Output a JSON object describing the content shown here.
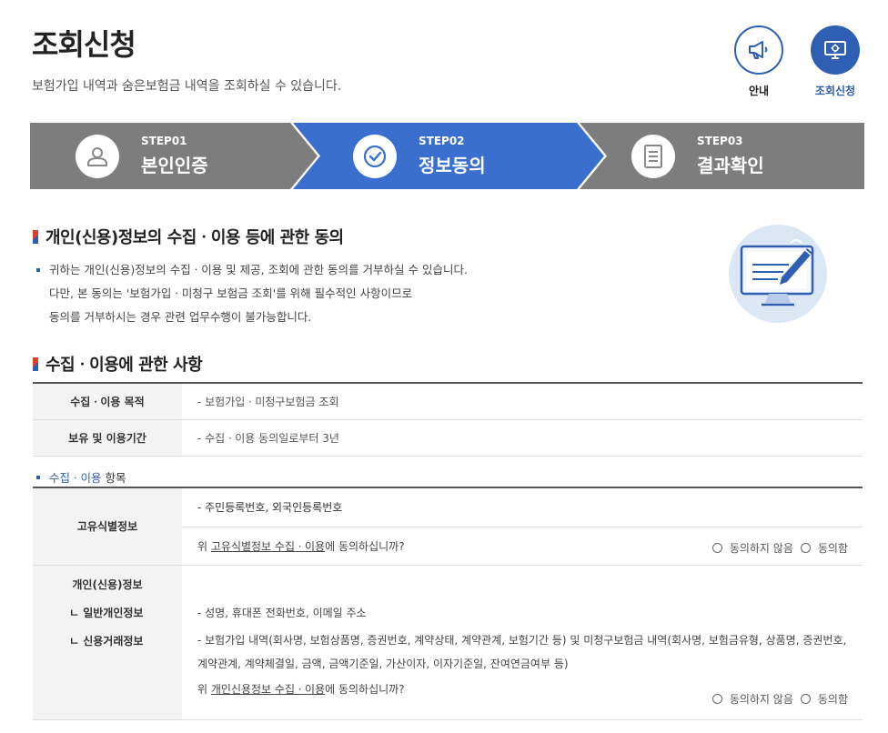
{
  "header": {
    "title": "조회신청",
    "subtitle": "보험가입 내역과 숨은보험금 내역을 조회하실 수 있습니다.",
    "guide_label": "안내",
    "inquiry_label": "조회신청",
    "guide_icon": "megaphone-icon",
    "inquiry_icon": "monitor-icon"
  },
  "steps": [
    {
      "num": "STEP01",
      "name": "본인인증",
      "icon": "person-icon"
    },
    {
      "num": "STEP02",
      "name": "정보동의",
      "icon": "check-circle-icon"
    },
    {
      "num": "STEP03",
      "name": "결과확인",
      "icon": "document-icon"
    }
  ],
  "consent": {
    "title": "개인(신용)정보의 수집ㆍ이용 등에 관한 동의",
    "lines": [
      "귀하는 개인(신용)정보의 수집ㆍ이용 및 제공, 조회에 관한 동의를 거부하실 수 있습니다.",
      "다만, 본 동의는 '보험가입ㆍ미청구 보험금 조회'를 위해 필수적인 사항이므로",
      "동의를 거부하시는 경우 관련 업무수행이 불가능합니다."
    ]
  },
  "collection": {
    "title": "수집ㆍ이용에 관한 사항",
    "rows": [
      {
        "label": "수집ㆍ이용 목적",
        "value": "- 보험가입ㆍ미청구보험금 조회"
      },
      {
        "label": "보유 및 이용기간",
        "value": "- 수집ㆍ이용 동의일로부터 3년"
      }
    ],
    "items_label_blue": "수집ㆍ이용",
    "items_label_rest": " 항목"
  },
  "items": {
    "unique": {
      "label": "고유식별정보",
      "value": "- 주민등록번호, 외국인등록번호",
      "question_pre": "위 ",
      "question_link": "고유식별정보 수집ㆍ이용",
      "question_post": "에 동의하십니까?"
    },
    "personal": {
      "label": "개인(신용)정보",
      "sub1": "ㄴ 일반개인정보",
      "sub2": "ㄴ 신용거래정보",
      "value1": "- 성명, 휴대폰 전화번호, 이메일 주소",
      "value2a": "- 보험가입 내역(회사명, 보험상품명, 증권번호, 계약상태, 계약관계, 보험기간 등) 및 미청구보험금 내역(회사명, 보험금유형, 상품명, 증권번호,",
      "value2b": "계약관계, 계약체결일, 금액, 금액기준일, 가산이자, 이자기준일, 잔여연금여부 등)",
      "question_pre": "위 ",
      "question_link": "개인신용정보 수집ㆍ이용",
      "question_post": "에 동의하십니까?"
    },
    "disagree_label": "동의하지 않음",
    "agree_label": "동의함"
  },
  "colors": {
    "accent": "#2f5fb3",
    "step_gray": "#7d7d7d",
    "step_active": "#3a6fd0"
  }
}
